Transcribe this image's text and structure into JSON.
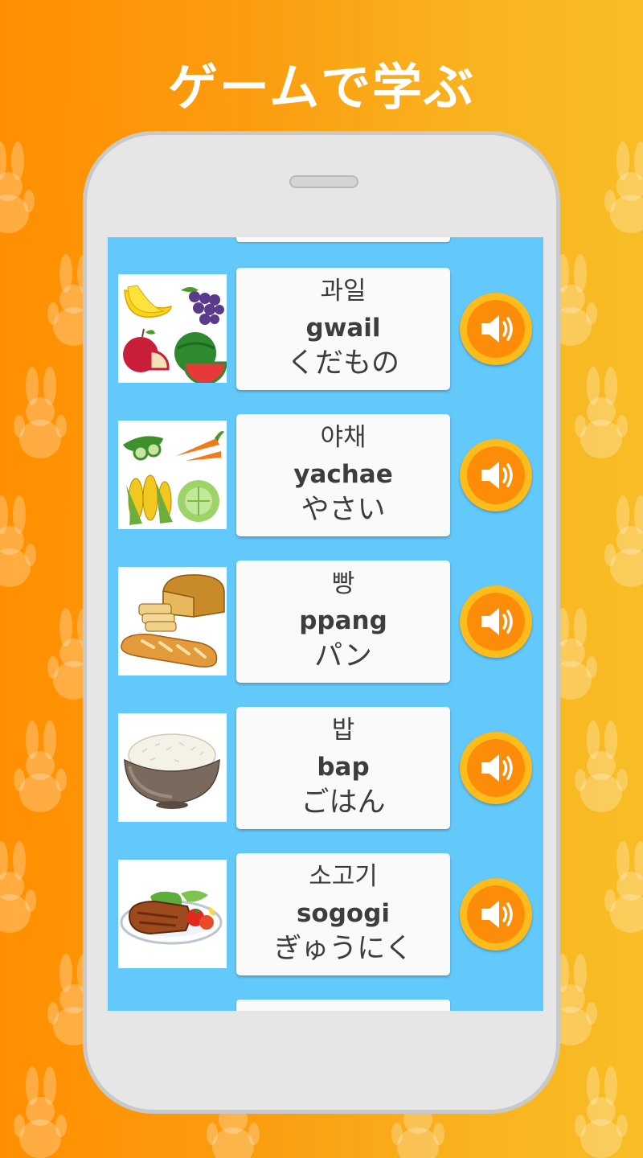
{
  "headline": "ゲームで学ぶ",
  "colors": {
    "background_left": "#ff8f00",
    "background_right": "#f8bd26",
    "screen": "#63c9fa",
    "sound_outer": "#fcbd1c",
    "sound_inner": "#fd8c09"
  },
  "vocab": [
    {
      "korean": "과일",
      "romanization": "gwail",
      "japanese": "くだもの",
      "image": "fruit-image",
      "icon": "speaker-icon"
    },
    {
      "korean": "야채",
      "romanization": "yachae",
      "japanese": "やさい",
      "image": "vegetables-image",
      "icon": "speaker-icon"
    },
    {
      "korean": "빵",
      "romanization": "ppang",
      "japanese": "パン",
      "image": "bread-image",
      "icon": "speaker-icon"
    },
    {
      "korean": "밥",
      "romanization": "bap",
      "japanese": "ごはん",
      "image": "rice-bowl-image",
      "icon": "speaker-icon"
    },
    {
      "korean": "소고기",
      "romanization": "sogogi",
      "japanese": "ぎゅうにく",
      "image": "beef-image",
      "icon": "speaker-icon"
    }
  ]
}
